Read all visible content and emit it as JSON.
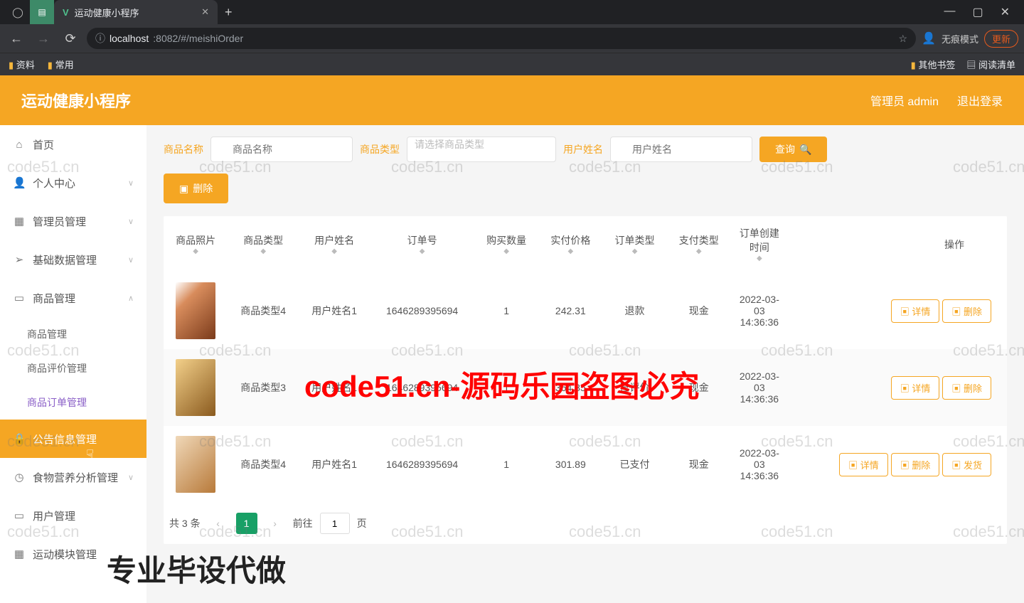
{
  "browser": {
    "tab_title": "运动健康小程序",
    "url_host": "localhost",
    "url_path": ":8082/#/meishiOrder",
    "incognito": "无痕模式",
    "update": "更新",
    "bookmarks": {
      "left": [
        "资料",
        "常用"
      ],
      "right": [
        "其他书签",
        "阅读清单"
      ]
    }
  },
  "header": {
    "title": "运动健康小程序",
    "admin": "管理员 admin",
    "logout": "退出登录"
  },
  "sidebar": {
    "items": [
      {
        "icon": "⌂",
        "label": "首页"
      },
      {
        "icon": "👤",
        "label": "个人中心",
        "arrow": "∨"
      },
      {
        "icon": "▦",
        "label": "管理员管理",
        "arrow": "∨"
      },
      {
        "icon": "➢",
        "label": "基础数据管理",
        "arrow": "∨"
      },
      {
        "icon": "▭",
        "label": "商品管理",
        "arrow": "∧"
      }
    ],
    "sub": [
      "商品管理",
      "商品评价管理",
      "商品订单管理"
    ],
    "items2": [
      {
        "icon": "🔒",
        "label": "公告信息管理"
      },
      {
        "icon": "◷",
        "label": "食物营养分析管理",
        "arrow": "∨"
      },
      {
        "icon": "▭",
        "label": "用户管理"
      },
      {
        "icon": "▦",
        "label": "运动模块管理"
      }
    ]
  },
  "search": {
    "name_label": "商品名称",
    "name_ph": "商品名称",
    "type_label": "商品类型",
    "type_ph": "请选择商品类型",
    "user_label": "用户姓名",
    "user_ph": "用户姓名",
    "query": "查询",
    "delete": "删除"
  },
  "table": {
    "headers": [
      "商品照片",
      "商品类型",
      "用户姓名",
      "订单号",
      "购买数量",
      "实付价格",
      "订单类型",
      "支付类型",
      "订单创建时间",
      "操作"
    ],
    "rows": [
      {
        "type": "商品类型4",
        "user": "用户姓名1",
        "order": "1646289395694",
        "qty": "1",
        "price": "242.31",
        "ordertype": "退款",
        "paytype": "现金",
        "time": "2022-03-03 14:36:36",
        "ops": [
          "详情",
          "删除"
        ]
      },
      {
        "type": "商品类型3",
        "user": "用户姓名1",
        "order": "1646289395694",
        "qty": "1",
        "price": "364.85",
        "ordertype": "已评价",
        "paytype": "现金",
        "time": "2022-03-03 14:36:36",
        "ops": [
          "详情",
          "删除"
        ]
      },
      {
        "type": "商品类型4",
        "user": "用户姓名1",
        "order": "1646289395694",
        "qty": "1",
        "price": "301.89",
        "ordertype": "已支付",
        "paytype": "现金",
        "time": "2022-03-03 14:36:36",
        "ops": [
          "详情",
          "删除",
          "发货"
        ]
      }
    ]
  },
  "pagination": {
    "total_pre": "共",
    "total_num": "3",
    "total_post": "条",
    "goto": "前往",
    "go_num": "1",
    "page": "页",
    "current": "1"
  },
  "watermark": "code51.cn",
  "headline": "code51.cn-源码乐园盗图必究",
  "footer": "专业毕设代做"
}
